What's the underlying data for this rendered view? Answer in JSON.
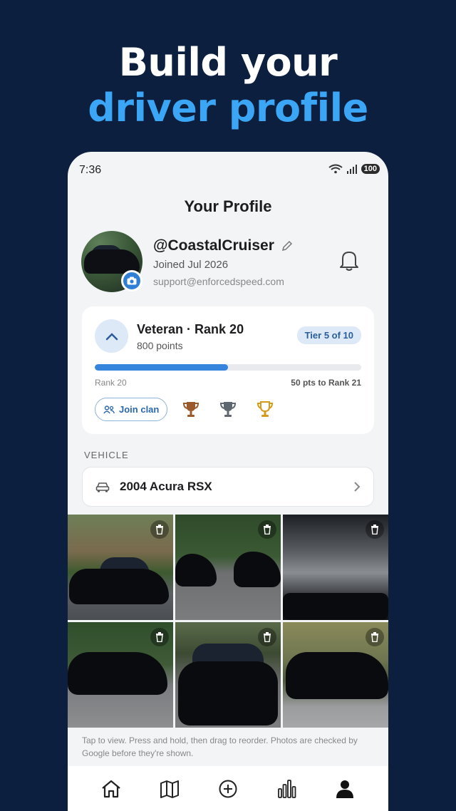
{
  "headline": {
    "line1": "Build your",
    "line2": "driver profile"
  },
  "status": {
    "time": "7:36",
    "battery": "100",
    "wifi_label": "6"
  },
  "page": {
    "title": "Your Profile"
  },
  "profile": {
    "handle": "@CoastalCruiser",
    "joined": "Joined Jul 2026",
    "email": "support@enforcedspeed.com"
  },
  "rank": {
    "title": "Veteran · Rank 20",
    "points": "800 points",
    "tier": "Tier 5 of 10",
    "progress": 0.5,
    "current_rank": "Rank 20",
    "next_rank_text": "50 pts to Rank 21",
    "join_clan": "Join clan",
    "trophies": [
      "bronze-trophy-icon",
      "silver-trophy-icon",
      "gold-trophy-icon"
    ]
  },
  "vehicle": {
    "section_label": "VEHICLE",
    "name": "2004 Acura RSX"
  },
  "photos_hint": "Tap to view. Press and hold, then drag to reorder. Photos are checked by Google before they're shown.",
  "tabs": [
    "home",
    "map",
    "add",
    "stats",
    "profile"
  ],
  "colors": {
    "background": "#0c1f3f",
    "accent": "#3aa6f5",
    "primary": "#3585dc"
  }
}
